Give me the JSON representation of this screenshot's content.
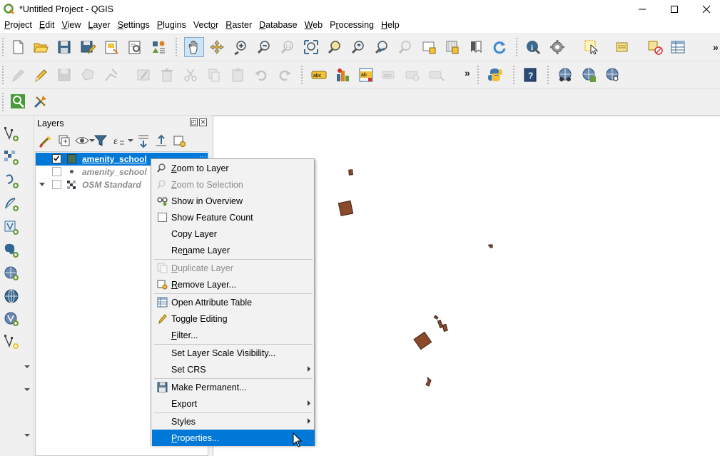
{
  "window": {
    "title": "*Untitled Project - QGIS"
  },
  "menubar": [
    {
      "label": "Project",
      "u": "P",
      "rest": "roject"
    },
    {
      "label": "Edit",
      "u": "E",
      "rest": "dit"
    },
    {
      "label": "View",
      "u": "V",
      "rest": "iew"
    },
    {
      "label": "Layer",
      "u": "L",
      "rest": "ayer"
    },
    {
      "label": "Settings",
      "u": "S",
      "rest": "ettings"
    },
    {
      "label": "Plugins",
      "u": "P",
      "rest": "lugins"
    },
    {
      "label": "Vector",
      "u": "o",
      "pre": "Vect",
      "rest": "r"
    },
    {
      "label": "Raster",
      "u": "R",
      "rest": "aster"
    },
    {
      "label": "Database",
      "u": "D",
      "rest": "atabase"
    },
    {
      "label": "Web",
      "u": "W",
      "rest": "eb"
    },
    {
      "label": "Processing",
      "u": "r",
      "pre": "P",
      "rest": "ocessing"
    },
    {
      "label": "Help",
      "u": "H",
      "rest": "elp"
    }
  ],
  "layers_panel": {
    "title": "Layers",
    "layers": [
      {
        "name": "amenity_school",
        "checked": true,
        "selected": true,
        "symbol": "polygon",
        "symbol_color": "#46705c"
      },
      {
        "name": "amenity_school",
        "checked": false,
        "selected": false,
        "symbol": "point"
      },
      {
        "name": "OSM Standard",
        "checked": false,
        "selected": false,
        "symbol": "raster",
        "expandable": true
      }
    ]
  },
  "context_menu": {
    "items": [
      {
        "label": "Zoom to Layer",
        "u": "Z",
        "rest": "oom to Layer",
        "icon": "zoom-layer-icon",
        "disabled": false
      },
      {
        "label": "Zoom to Selection",
        "u": "Z",
        "rest": "oom to Selection",
        "icon": "zoom-selection-icon",
        "disabled": true
      },
      {
        "label": "Show in Overview",
        "icon": "overview-icon",
        "disabled": false
      },
      {
        "label": "Show Feature Count",
        "icon": "checkbox-icon",
        "disabled": false
      },
      {
        "label": "Copy Layer",
        "disabled": false
      },
      {
        "label": "Rename Layer",
        "pre": "Re",
        "u": "n",
        "rest": "ame Layer",
        "disabled": false
      },
      {
        "separator": true
      },
      {
        "label": "Duplicate Layer",
        "u": "D",
        "rest": "uplicate Layer",
        "icon": "duplicate-icon",
        "disabled": true
      },
      {
        "label": "Remove Layer...",
        "u": "R",
        "rest": "emove Layer...",
        "icon": "remove-icon",
        "disabled": false
      },
      {
        "separator": true
      },
      {
        "label": "Open Attribute Table",
        "icon": "attribute-table-icon",
        "disabled": false
      },
      {
        "label": "Toggle Editing",
        "icon": "pencil-icon",
        "disabled": false
      },
      {
        "label": "Filter...",
        "u": "F",
        "rest": "ilter...",
        "disabled": false
      },
      {
        "separator": true
      },
      {
        "label": "Set Layer Scale Visibility...",
        "disabled": false
      },
      {
        "label": "Set CRS",
        "submenu": true,
        "disabled": false
      },
      {
        "separator": true
      },
      {
        "label": "Make Permanent...",
        "icon": "save-icon",
        "disabled": false
      },
      {
        "label": "Export",
        "submenu": true,
        "disabled": false
      },
      {
        "separator": true
      },
      {
        "label": "Styles",
        "submenu": true,
        "disabled": false
      },
      {
        "label": "Properties...",
        "u": "P",
        "rest": "roperties...",
        "highlighted": true,
        "disabled": false
      }
    ]
  },
  "colors": {
    "selection": "#0078d7",
    "feature_fill": "#8b4a2b",
    "feature_stroke": "#3a2316"
  }
}
